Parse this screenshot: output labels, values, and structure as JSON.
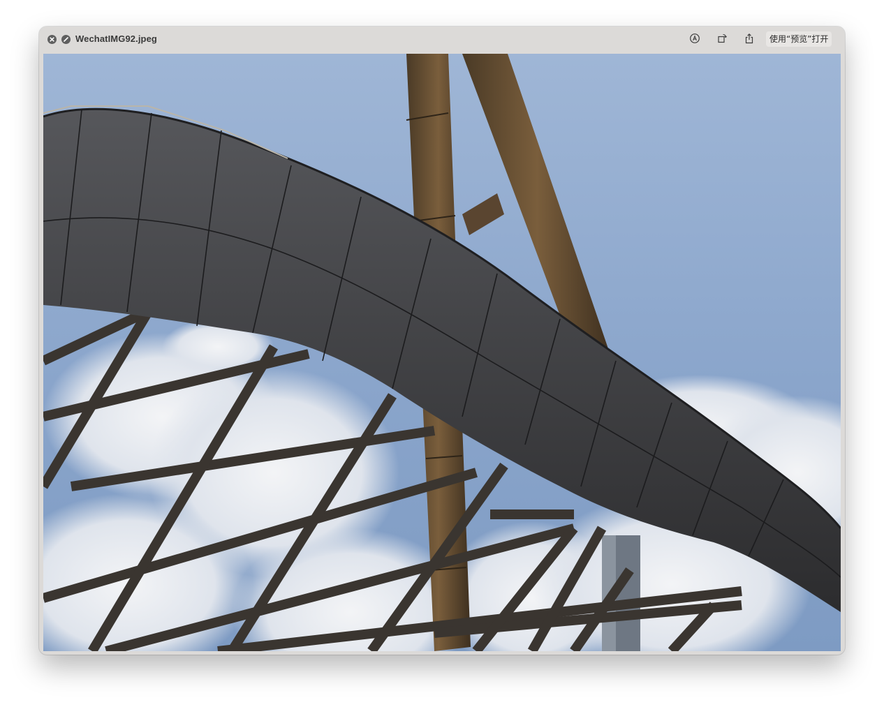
{
  "window": {
    "title": "WechatIMG92.jpeg",
    "open_with_label": "使用“预览”打开"
  },
  "icons": {
    "close": "close-icon",
    "fullscreen": "fullscreen-icon",
    "markup": "markup-pen-icon",
    "rotate": "rotate-icon",
    "share": "share-icon"
  },
  "colors": {
    "titlebar": "#dcdad8",
    "sky": "#8fa9cd",
    "structure": "#3b3b3d",
    "column": "#6b5234"
  }
}
